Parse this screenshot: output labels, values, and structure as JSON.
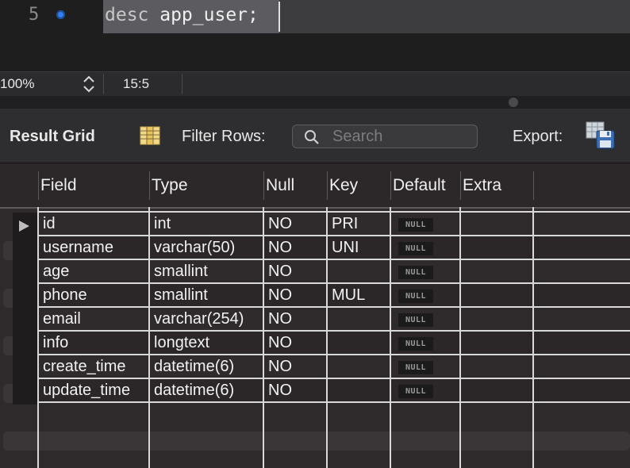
{
  "editor": {
    "line_number": "5",
    "code_keyword": "desc",
    "code_rest": " app_user;"
  },
  "statusbar": {
    "zoom": "100%",
    "cursor_position": "15:5"
  },
  "toolbar": {
    "result_grid_label": "Result Grid",
    "filter_rows_label": "Filter Rows:",
    "search_placeholder": "Search",
    "export_label": "Export:"
  },
  "grid": {
    "columns": [
      "Field",
      "Type",
      "Null",
      "Key",
      "Default",
      "Extra"
    ],
    "rows": [
      {
        "field": "id",
        "type": "int",
        "null": "NO",
        "key": "PRI",
        "default": "NULL",
        "extra": ""
      },
      {
        "field": "username",
        "type": "varchar(50)",
        "null": "NO",
        "key": "UNI",
        "default": "NULL",
        "extra": ""
      },
      {
        "field": "age",
        "type": "smallint",
        "null": "NO",
        "key": "",
        "default": "NULL",
        "extra": ""
      },
      {
        "field": "phone",
        "type": "smallint",
        "null": "NO",
        "key": "MUL",
        "default": "NULL",
        "extra": ""
      },
      {
        "field": "email",
        "type": "varchar(254)",
        "null": "NO",
        "key": "",
        "default": "NULL",
        "extra": ""
      },
      {
        "field": "info",
        "type": "longtext",
        "null": "NO",
        "key": "",
        "default": "NULL",
        "extra": ""
      },
      {
        "field": "create_time",
        "type": "datetime(6)",
        "null": "NO",
        "key": "",
        "default": "NULL",
        "extra": ""
      },
      {
        "field": "update_time",
        "type": "datetime(6)",
        "null": "NO",
        "key": "",
        "default": "NULL",
        "extra": ""
      }
    ]
  },
  "colors": {
    "breakpoint": "#2f7ff0",
    "grid_background": "#2f2a2b",
    "grid_lines": "#d8d8d8"
  }
}
